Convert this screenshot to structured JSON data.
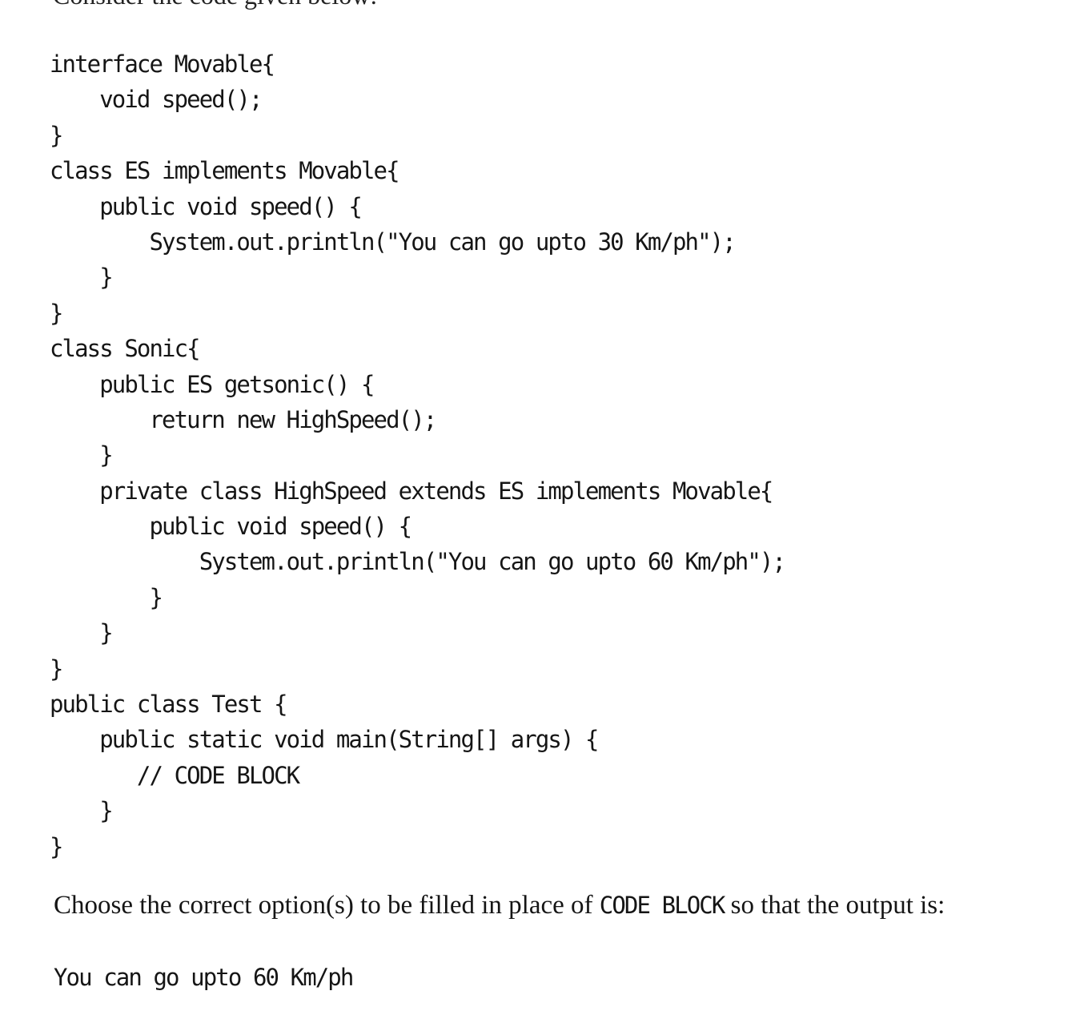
{
  "intro": "Consider the code given below:",
  "code_lines": [
    "interface Movable{",
    "    void speed();",
    "}",
    "class ES implements Movable{",
    "    public void speed() {",
    "        System.out.println(\"You can go upto 30 Km/ph\");",
    "    }",
    "}",
    "class Sonic{",
    "    public ES getsonic() {",
    "        return new HighSpeed();",
    "    }",
    "    private class HighSpeed extends ES implements Movable{",
    "        public void speed() {",
    "            System.out.println(\"You can go upto 60 Km/ph\");",
    "        }",
    "    }",
    "}",
    "public class Test {",
    "    public static void main(String[] args) {",
    "       // CODE BLOCK",
    "    }",
    "}"
  ],
  "question": {
    "before": "Choose the correct option(s) to be filled in place of ",
    "code_ref": "CODE BLOCK",
    "after": " so that the output is:"
  },
  "expected_output": "You can go upto 60 Km/ph"
}
